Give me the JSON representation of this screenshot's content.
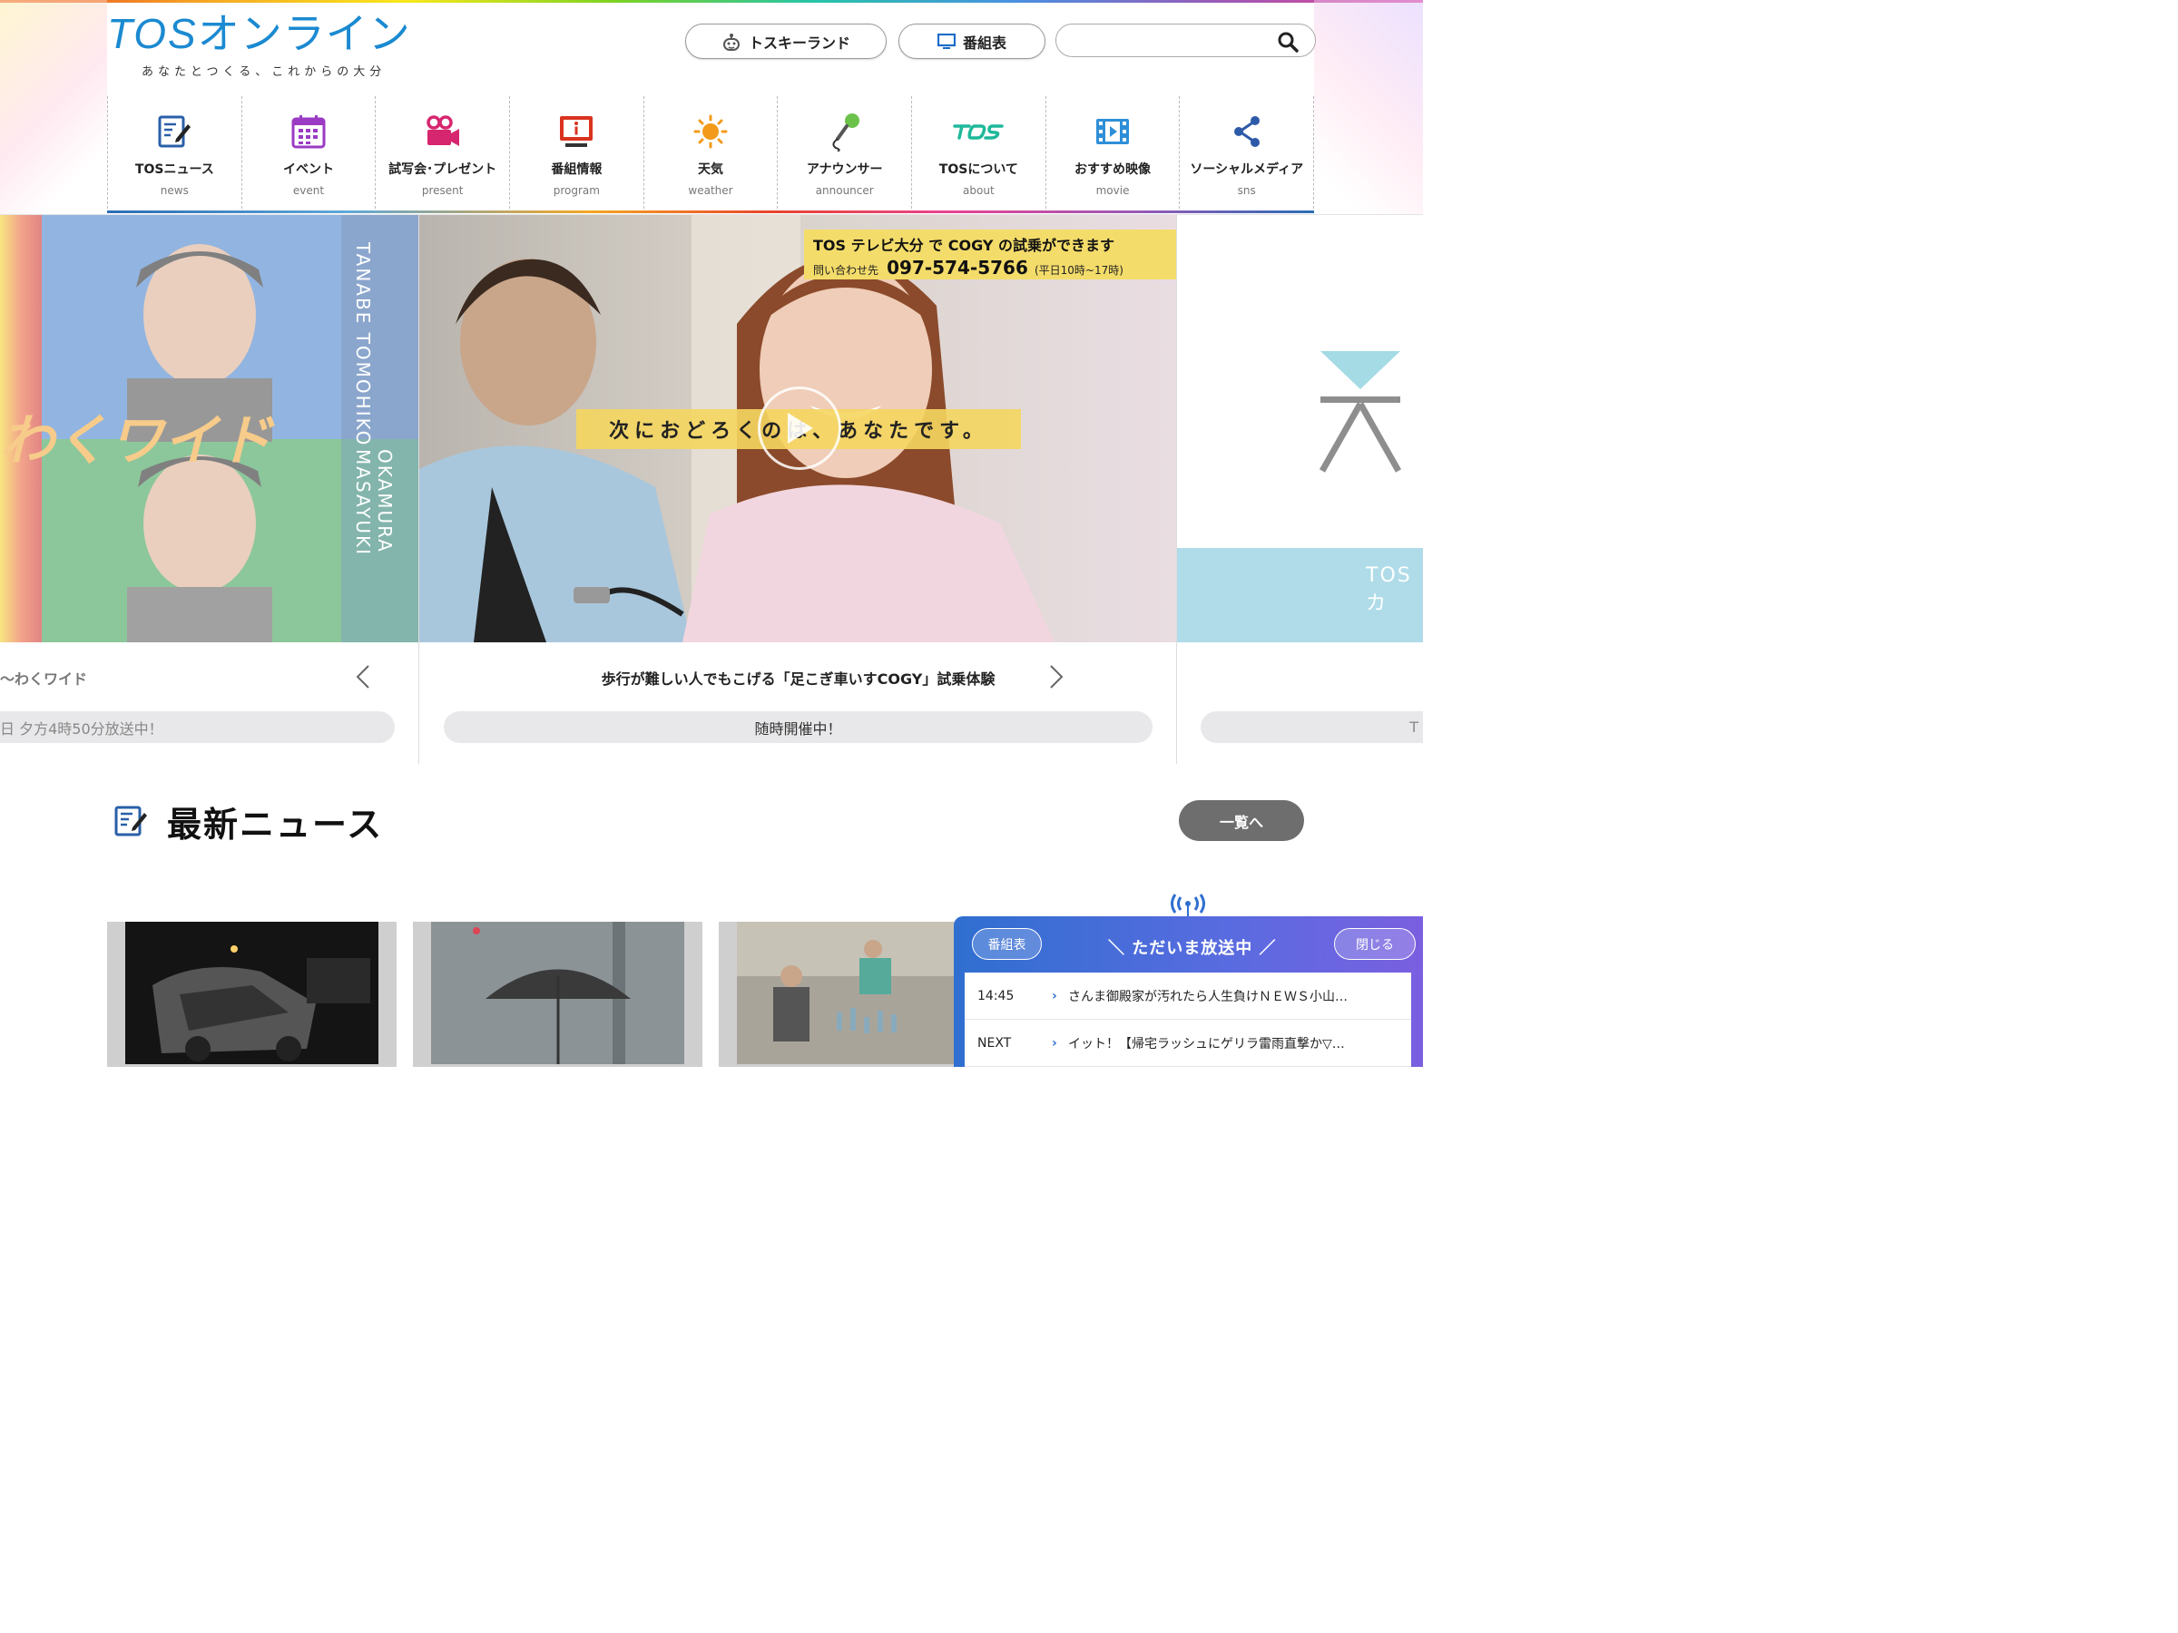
{
  "header": {
    "logo_main_latin": "TOS",
    "logo_main_kana": "オンライン",
    "logo_sub": "あなたとつくる、これからの大分",
    "tosky_label": "トスキーランド",
    "bangumi_label": "番組表",
    "search_placeholder": ""
  },
  "nav": {
    "items": [
      {
        "label": "TOSニュース",
        "sub": "news",
        "icon": "news-icon"
      },
      {
        "label": "イベント",
        "sub": "event",
        "icon": "calendar-icon"
      },
      {
        "label": "試写会･プレゼント",
        "sub": "present",
        "icon": "movie-camera-icon"
      },
      {
        "label": "番組情報",
        "sub": "program",
        "icon": "info-monitor-icon"
      },
      {
        "label": "天気",
        "sub": "weather",
        "icon": "sun-icon"
      },
      {
        "label": "アナウンサー",
        "sub": "announcer",
        "icon": "microphone-icon"
      },
      {
        "label": "TOSについて",
        "sub": "about",
        "icon": "tos-logo-icon"
      },
      {
        "label": "おすすめ映像",
        "sub": "movie",
        "icon": "film-icon"
      },
      {
        "label": "ソーシャルメディア",
        "sub": "sns",
        "icon": "share-icon"
      }
    ]
  },
  "carousel": {
    "left": {
      "caption": "〜わくワイド",
      "badge": "日 夕方4時50分放送中！",
      "logo_text": "わくワイド",
      "name1": "TANABE TOMOHIKO",
      "name2": "OKAMURA MASAYUKI"
    },
    "center": {
      "caption": "歩行が難しい人でもこげる「足こぎ車いすCOGY」試乗体験",
      "badge": "随時開催中！",
      "banner_line1": "TOS テレビ大分 で COGY の試乗ができます",
      "banner_inquiry": "問い合わせ先",
      "banner_phone": "097-574-5766",
      "banner_hours": "(平日10時~17時)",
      "tagline": "次におどろくのは、あなたです。"
    },
    "right": {
      "partial_text": "TOSカ",
      "badge": "T"
    }
  },
  "news": {
    "title": "最新ニュース",
    "more_label": "一覧へ"
  },
  "onair": {
    "schedule_label": "番組表",
    "title": "＼ ただいま放送中 ／",
    "close_label": "閉じる",
    "rows": [
      {
        "time": "14:45",
        "text": "さんま御殿家が汚れたら人生負けＮＥＷＳ小山…"
      },
      {
        "time": "NEXT",
        "text": "イット！【帰宅ラッシュにゲリラ雷雨直撃か▽…"
      }
    ]
  },
  "colors": {
    "brand_blue": "#1b8ad1",
    "onair_gradient_start": "#2f6fd0",
    "onair_gradient_end": "#7a5fe0",
    "badge_bg": "#e8e8ea",
    "more_button_bg": "#6e6e6e"
  }
}
